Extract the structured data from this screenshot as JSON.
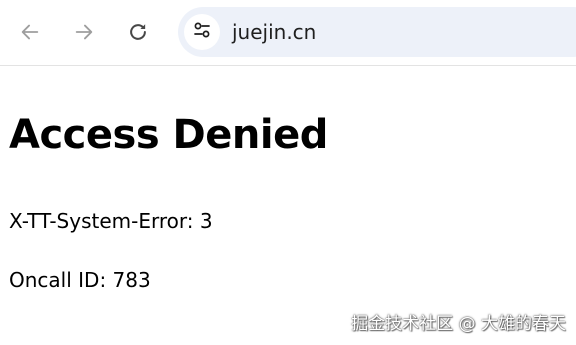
{
  "browser": {
    "url": "juejin.cn",
    "icons": {
      "back": "arrow-left-icon",
      "forward": "arrow-right-icon",
      "reload": "reload-icon",
      "site_info": "tune-icon"
    },
    "colors": {
      "omnibox_bg": "#edf1f9",
      "icon_disabled": "#9e9e9e",
      "icon_active": "#474747"
    }
  },
  "page": {
    "title": "Access Denied",
    "error_line": "X-TT-System-Error: 3",
    "oncall_line": "Oncall ID: 783"
  },
  "watermark": "掘金技术社区 @ 大雄的春天"
}
